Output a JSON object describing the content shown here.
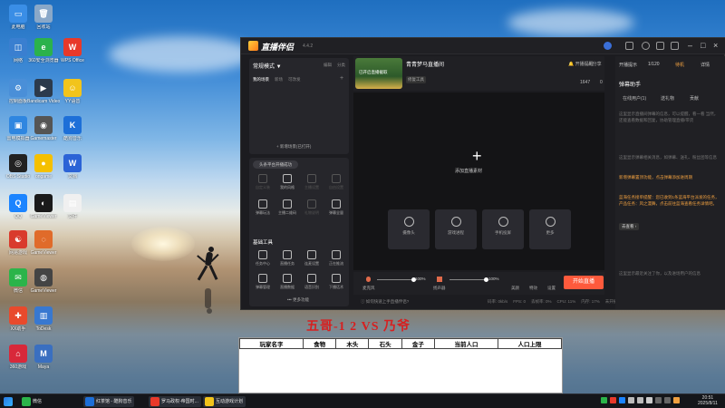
{
  "desktop": {
    "icons": [
      {
        "label": "此电脑",
        "color": "#3a8ee6",
        "glyph": "▭"
      },
      {
        "label": "回收站",
        "color": "#8aa8c8",
        "glyph": "🗑"
      },
      {
        "label": "网络",
        "color": "#3a7fd0",
        "glyph": "◫"
      },
      {
        "label": "360安全浏览器",
        "color": "#2bb24c",
        "glyph": "e"
      },
      {
        "label": "WPS Office",
        "color": "#e8392a",
        "glyph": "W"
      },
      {
        "label": "控制面板",
        "color": "#4a8fd8",
        "glyph": "⚙"
      },
      {
        "label": "Bandicam Video Editor",
        "color": "#2c3a4c",
        "glyph": "▶"
      },
      {
        "label": "YY语音",
        "color": "#f2c41b",
        "glyph": "☺"
      },
      {
        "label": "雷电模拟器",
        "color": "#2f86e0",
        "glyph": "▣"
      },
      {
        "label": "Gamemaster",
        "color": "#555555",
        "glyph": "◉"
      },
      {
        "label": "酷狗音乐",
        "color": "#1d6fd8",
        "glyph": "K"
      },
      {
        "label": "OBS Studio",
        "color": "#222222",
        "glyph": "◎"
      },
      {
        "label": "ongame",
        "color": "#f5c000",
        "glyph": "●"
      },
      {
        "label": "文档",
        "color": "#2b63d6",
        "glyph": "W"
      },
      {
        "label": "QQ",
        "color": "#1b84ff",
        "glyph": "Q"
      },
      {
        "label": "GameViewer",
        "color": "#1a1a1a",
        "glyph": "◐"
      },
      {
        "label": "文件",
        "color": "#f0f0f0",
        "glyph": "▤"
      },
      {
        "label": "网易游戏",
        "color": "#d93b2c",
        "glyph": "☯"
      },
      {
        "label": "GameViewer",
        "color": "#e06b2a",
        "glyph": "◌"
      },
      {
        "label": "微信",
        "color": "#2bb44a",
        "glyph": "✉"
      },
      {
        "label": "GameViewer",
        "color": "#444444",
        "glyph": "◍"
      },
      {
        "label": "XX助手",
        "color": "#e84a2c",
        "glyph": "✚"
      },
      {
        "label": "ToDesk",
        "color": "#3878d0",
        "glyph": "▥"
      },
      {
        "label": "360游戏",
        "color": "#d8283a",
        "glyph": "⌂"
      },
      {
        "label": "Maya",
        "color": "#3a6fc0",
        "glyph": "M"
      }
    ]
  },
  "app": {
    "title": "直播伴侣",
    "version": "4.4.2",
    "left": {
      "mode_label": "常规模式 ▼",
      "edit": "编辑",
      "more": "分类",
      "tabs": [
        "我的场景",
        "新场",
        "可改发"
      ],
      "add_scene": "+ 新增场景(已打开) ",
      "status_banner": "头条平台开播成功",
      "tools_row1": [
        "自定义装",
        "我的风格",
        "主播设置",
        "自由设置"
      ],
      "tools_row2": [
        "弹幕玩法",
        "主播二维码",
        "礼物说明",
        "弹幕全量"
      ],
      "basic_tools_label": "基础工具",
      "tools_row3": [
        "任务中心",
        "直播任务",
        "连麦设置",
        "正在推流"
      ],
      "tools_row4": [
        "弹幕管理",
        "直播数据",
        "语音识别",
        "下播话术"
      ],
      "more_features": "••• 更多功能"
    },
    "center": {
      "scene_title": "青青梦马直播间",
      "scene_sub": "已开启直播截取",
      "tags": [
        "修复工具",
        "连麦"
      ],
      "counter_likes": "1647",
      "counter_hearts": "0",
      "add_source": "添加直播素材",
      "sources": [
        "摄像头",
        "游戏进程",
        "手机投屏",
        "更多"
      ],
      "mic_label": "麦克风",
      "mic_level": "100%",
      "speaker_label": "扬声器",
      "speaker_level": "100%",
      "extra_buttons": [
        "美颜",
        "特效",
        "设置"
      ],
      "start_live": "开始直播",
      "hint": "ⓘ 如何快速上手直播伴侣?",
      "stats": [
        "码率: 0kb/s",
        "FPS: 0",
        "丢帧率: 0%",
        "CPU: 11%",
        "内存: 17%",
        "未开播"
      ]
    },
    "right": {
      "tabs": [
        "开播提示",
        "1/120",
        "待机",
        "详情"
      ],
      "assistant_title": "弹幕助手",
      "sub_tabs": [
        "在线用户(1)",
        "送礼物",
        "贡献"
      ],
      "hint1": "这里显示直播间弹幕的信息，可以提醒，看一看 当然，还能查看数据和回复，协助管理直播/带货",
      "hint2": "这里显示弹幕相关消息，如弹幕、送礼、粉丝团等信息",
      "orange1": "新增弹幕置顶功能，点击弹幕添加进周期",
      "orange2": "蓝海任务接单提醒：您已收到1条蓝海平台派发的任务，产品任务：风之漫舞，点击前往蓝海查看任务详情吧。",
      "view_link": "去查看 ›",
      "hint3": "这里显示最近关注了你，以及进场用户的信息"
    }
  },
  "overlay": {
    "banner": "五哥-1 2 VS 乃爷",
    "sheet_headers": [
      "玩家名字",
      "食物",
      "木头",
      "石头",
      "金子",
      "当前人口",
      "人口上限"
    ],
    "sheet_rows": 5
  },
  "taskbar": {
    "tasks": [
      {
        "label": "微信",
        "color": "#2bb44a",
        "active": false
      },
      {
        "label": "红茶馆 - 酷狗音乐",
        "color": "#1d6fd8",
        "active": true
      },
      {
        "label": "罗马政权-帝国时...",
        "color": "#e8392a",
        "active": true
      },
      {
        "label": "互动游戏计划",
        "color": "#f2c41b",
        "active": true
      }
    ],
    "time": "20:51",
    "date": "2025/8/11"
  }
}
